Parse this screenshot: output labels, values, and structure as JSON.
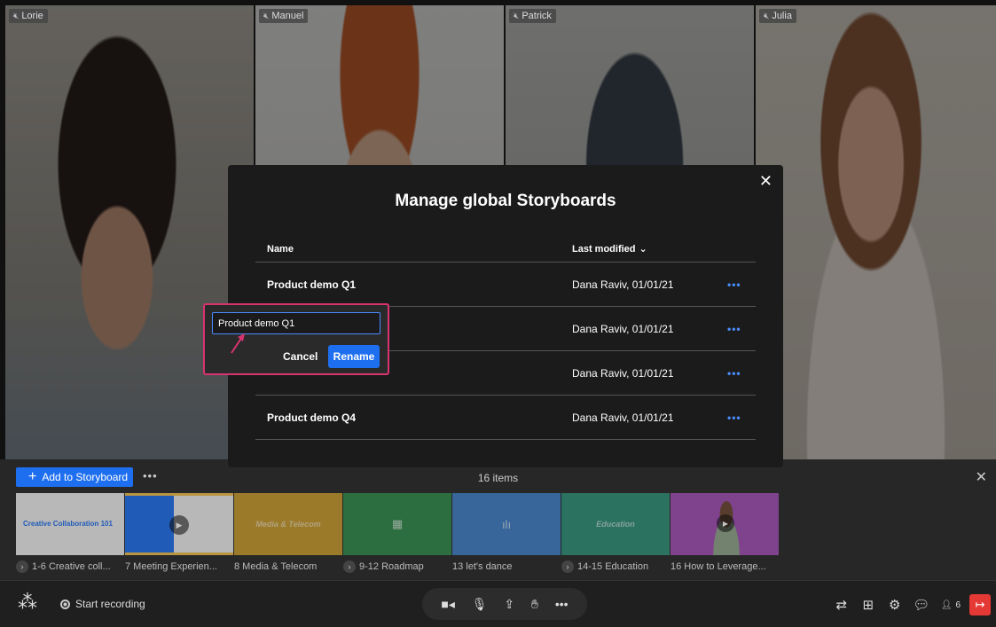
{
  "participants": [
    {
      "name": "Lorie"
    },
    {
      "name": "Manuel"
    },
    {
      "name": "Patrick"
    },
    {
      "name": "Julia"
    }
  ],
  "modal": {
    "title": "Manage global Storyboards",
    "col_name": "Name",
    "col_modified": "Last modified",
    "rows": [
      {
        "name": "Product demo Q1",
        "modified": "Dana Raviv, 01/01/21"
      },
      {
        "name": "",
        "modified": "Dana Raviv, 01/01/21"
      },
      {
        "name": "",
        "modified": "Dana Raviv, 01/01/21"
      },
      {
        "name": "Product demo Q4",
        "modified": "Dana Raviv, 01/01/21"
      }
    ]
  },
  "rename": {
    "value": "Product demo Q1",
    "cancel": "Cancel",
    "confirm": "Rename"
  },
  "storyboard": {
    "add_label": "Add to Storyboard",
    "count": "16 items",
    "thumb1_title": "Creative Collaboration 101",
    "thumb3_caption": "Media & Telecom",
    "thumb6_caption": "Education",
    "labels": [
      {
        "text": "1-6 Creative coll...",
        "group": true
      },
      {
        "text": "7 Meeting Experien...",
        "group": false
      },
      {
        "text": "8 Media & Telecom",
        "group": false
      },
      {
        "text": "9-12 Roadmap",
        "group": true
      },
      {
        "text": "13 let's dance",
        "group": false
      },
      {
        "text": "14-15 Education",
        "group": true
      },
      {
        "text": "16 How to Leverage...",
        "group": false
      }
    ]
  },
  "controls": {
    "record": "Start recording",
    "participant_count": "6"
  },
  "colors": {
    "accent": "#1e6ff0",
    "highlight": "#d9336f",
    "leave": "#e53935"
  }
}
